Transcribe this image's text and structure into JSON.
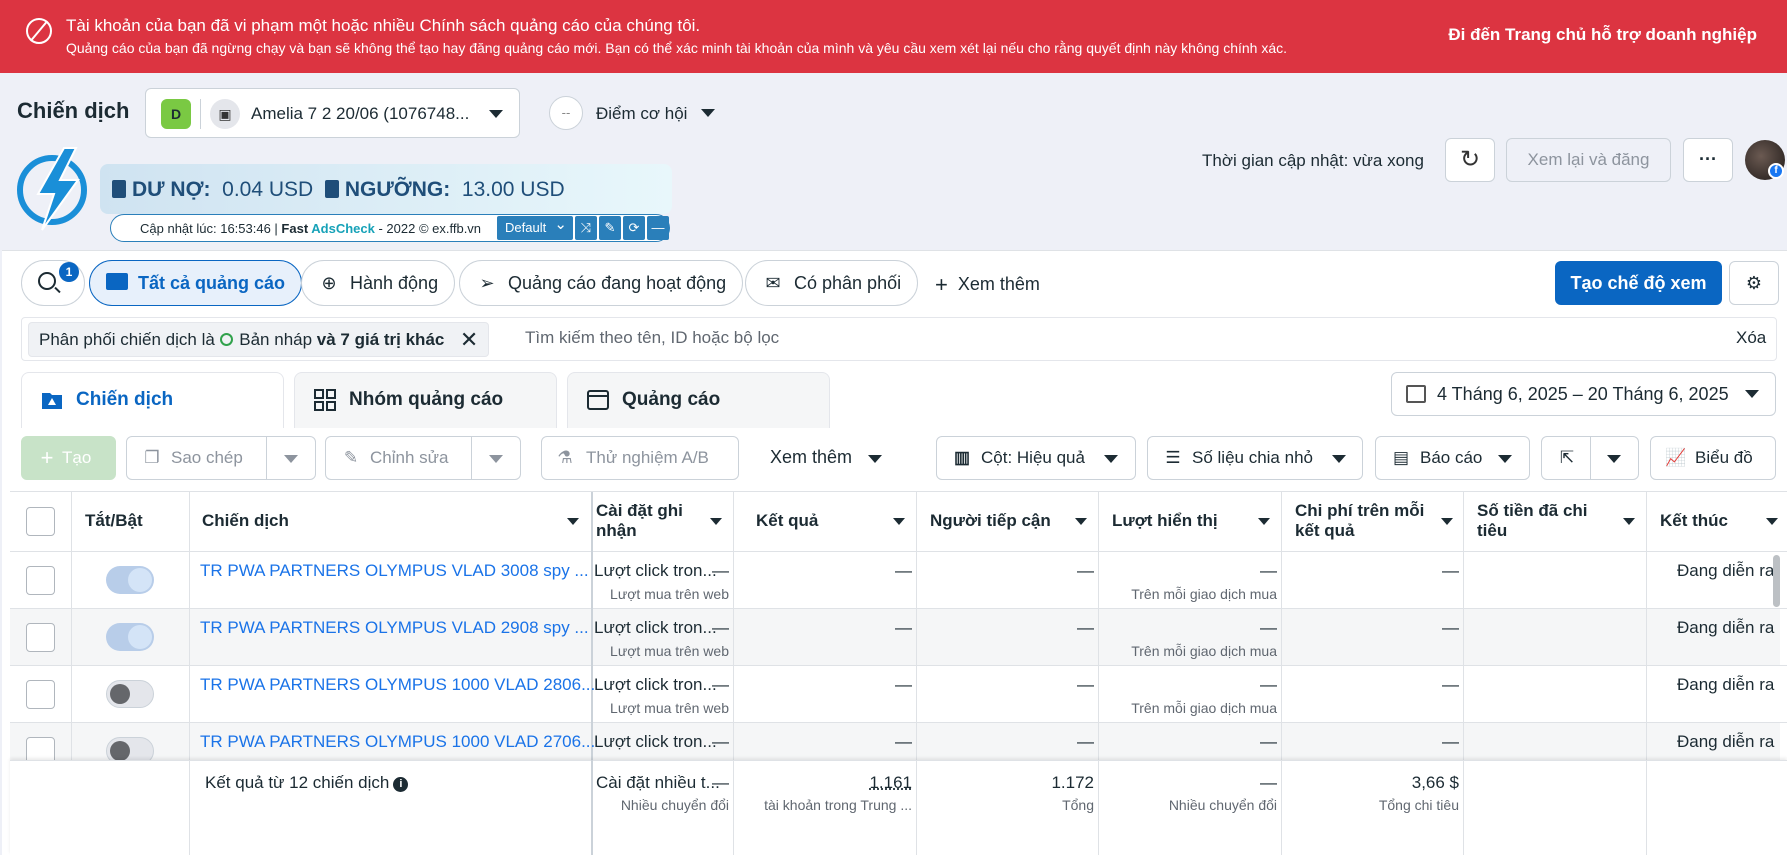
{
  "banner": {
    "title": "Tài khoản của bạn đã vi phạm một hoặc nhiều Chính sách quảng cáo của chúng tôi.",
    "subtitle": "Quảng cáo của bạn đã ngừng chạy và bạn sẽ không thể tạo hay đăng quảng cáo mới. Bạn có thể xác minh tài khoản của mình và yêu cầu xem xét lại nếu cho rằng quyết định này không chính xác.",
    "link": "Đi đến Trang chủ hỗ trợ doanh nghiệp",
    "color": "#dc3441"
  },
  "header": {
    "title": "Chiến dịch",
    "account_badge": "D",
    "account_name": "Amelia 7 2 20/06 (1076748...",
    "opportunity_icon": "--",
    "opportunity_label": "Điểm cơ hội",
    "update_time": "Thời gian cập nhật: vừa xong",
    "review_button": "Xem lại và đăng",
    "more_button": "···"
  },
  "extension": {
    "debt_label": "DƯ NỢ:",
    "debt_value": "0.04 USD",
    "threshold_label": "NGƯỠNG:",
    "threshold_value": "13.00 USD",
    "updated_prefix": "Cập nhật lúc: 16:53:46 | ",
    "brand_a": "Fast ",
    "brand_b": "AdsCheck",
    "updated_suffix": " - 2022 © ex.ffb.vn",
    "preset": "Default"
  },
  "filters": {
    "search_badge": "1",
    "chips": [
      "Tất cả quảng cáo",
      "Hành động",
      "Quảng cáo đang hoạt động",
      "Có phân phối"
    ],
    "more": "Xem thêm",
    "create_view": "Tạo chế độ xem",
    "active_filter_prefix": "Phân phối chiến dịch là ",
    "active_filter_value": "Bản nháp",
    "active_filter_suffix": " và 7 giá trị khác",
    "search_placeholder": "Tìm kiếm theo tên, ID hoặc bộ lọc",
    "clear": "Xóa"
  },
  "level_tabs": [
    "Chiến dịch",
    "Nhóm quảng cáo",
    "Quảng cáo"
  ],
  "date_range": "4 Tháng 6, 2025 – 20 Tháng 6, 2025",
  "toolbar": {
    "create": "Tạo",
    "copy": "Sao chép",
    "edit": "Chỉnh sửa",
    "ab_test": "Thử nghiệm A/B",
    "more": "Xem thêm",
    "columns": "Cột: Hiệu quả",
    "breakdown": "Số liệu chia nhỏ",
    "reports": "Báo cáo",
    "chart": "Biểu đồ"
  },
  "table": {
    "headers": {
      "toggle": "Tắt/Bật",
      "campaign": "Chiến dịch",
      "attribution_line1": "Cài đặt ghi",
      "attribution_line2": "nhận",
      "results": "Kết quả",
      "reach": "Người tiếp cận",
      "impressions": "Lượt hiển thị",
      "cpr_line1": "Chi phí trên mỗi",
      "cpr_line2": "kết quả",
      "spent_line1": "Số tiền đã chi",
      "spent_line2": "tiêu",
      "ends": "Kết thúc"
    },
    "rows": [
      {
        "on": true,
        "name": "TR PWA PARTNERS OLYMPUS VLAD 3008 spy ...",
        "attribution": "Lượt click tron...",
        "result": "—",
        "result_sub": "Lượt mua trên web",
        "reach": "—",
        "impressions": "—",
        "cpr": "—",
        "cpr_sub": "Trên mỗi giao dịch mua",
        "spent": "—",
        "ends": "Đang diễn ra"
      },
      {
        "on": true,
        "name": "TR PWA PARTNERS OLYMPUS VLAD 2908 spy ...",
        "attribution": "Lượt click tron...",
        "result": "—",
        "result_sub": "Lượt mua trên web",
        "reach": "—",
        "impressions": "—",
        "cpr": "—",
        "cpr_sub": "Trên mỗi giao dịch mua",
        "spent": "—",
        "ends": "Đang diễn ra"
      },
      {
        "on": false,
        "name": "TR PWA PARTNERS OLYMPUS 1000 VLAD 2806...",
        "attribution": "Lượt click tron...",
        "result": "—",
        "result_sub": "Lượt mua trên web",
        "reach": "—",
        "impressions": "—",
        "cpr": "—",
        "cpr_sub": "Trên mỗi giao dịch mua",
        "spent": "—",
        "ends": "Đang diễn ra"
      },
      {
        "on": false,
        "name": "TR PWA PARTNERS OLYMPUS 1000 VLAD 2706...",
        "attribution": "Lượt click tron...",
        "result": "—",
        "result_sub": "",
        "reach": "—",
        "impressions": "—",
        "cpr": "—",
        "cpr_sub": "",
        "spent": "—",
        "ends": "Đang diễn ra"
      }
    ],
    "summary": {
      "label": "Kết quả từ 12 chiến dịch",
      "attribution": "Cài đặt nhiều t...",
      "result": "—",
      "result_sub": "Nhiều chuyển đổi",
      "reach": "1.161",
      "reach_sub": "tài khoản trong Trung ...",
      "impressions": "1.172",
      "impressions_sub": "Tổng",
      "cpr": "—",
      "cpr_sub": "Nhiều chuyển đổi",
      "spent": "3,66 $",
      "spent_sub": "Tổng chi tiêu"
    }
  },
  "colors": {
    "accent": "#0a66c2",
    "link": "#1a73e8",
    "banner": "#dc3441"
  }
}
